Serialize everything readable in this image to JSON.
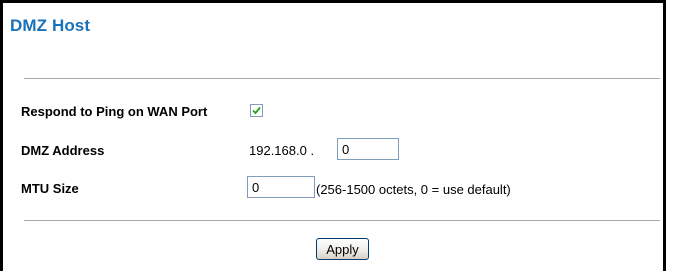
{
  "page_title": "DMZ Host",
  "respond_ping": {
    "label": "Respond to Ping on WAN Port",
    "checked": true
  },
  "dmz_address": {
    "label": "DMZ Address",
    "prefix": "192.168.0 .",
    "last_octet": "0"
  },
  "mtu": {
    "label": "MTU Size",
    "value": "0",
    "hint": "(256-1500 octets, 0 = use default)"
  },
  "actions": {
    "apply_label": "Apply"
  },
  "colors": {
    "title": "#1a73b8",
    "rule": "#a8a8a8",
    "input_border": "#7f9db9"
  }
}
